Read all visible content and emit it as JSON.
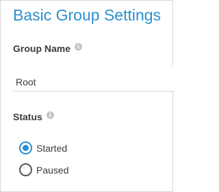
{
  "panel": {
    "title": "Basic Group Settings"
  },
  "group_name": {
    "label": "Group Name",
    "value": "Root",
    "info_icon": "info-icon"
  },
  "status": {
    "label": "Status",
    "info_icon": "info-icon",
    "options": [
      {
        "label": "Started",
        "selected": true
      },
      {
        "label": "Paused",
        "selected": false
      }
    ]
  },
  "colors": {
    "accent": "#2b8fcf",
    "text": "#3b3b3b",
    "icon": "#c4c4c4"
  }
}
